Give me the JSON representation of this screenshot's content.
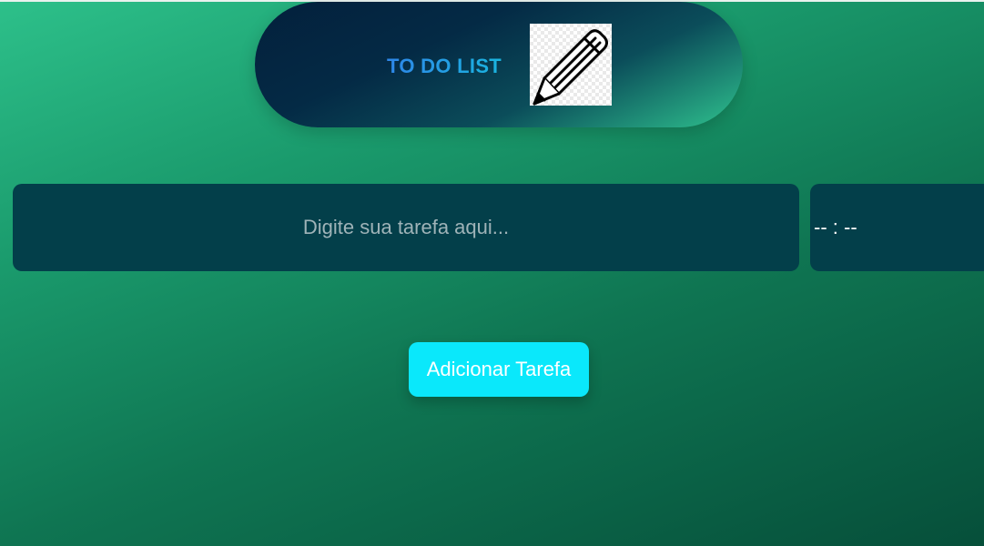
{
  "header": {
    "title": "TO DO LIST",
    "icon": "pencil-icon",
    "title_gradient": [
      "#2e86e8",
      "#1ab5e0"
    ]
  },
  "form": {
    "task_placeholder": "Digite sua tarefa aqui...",
    "task_value": "",
    "time_value": "-- : --",
    "add_button_label": "Adicionar Tarefa"
  },
  "colors": {
    "background_start": "#2dc08a",
    "background_end": "#064f3a",
    "input_background": "#033f4a",
    "button_background": "#0ae8fb",
    "header_dark": "#03203c"
  }
}
